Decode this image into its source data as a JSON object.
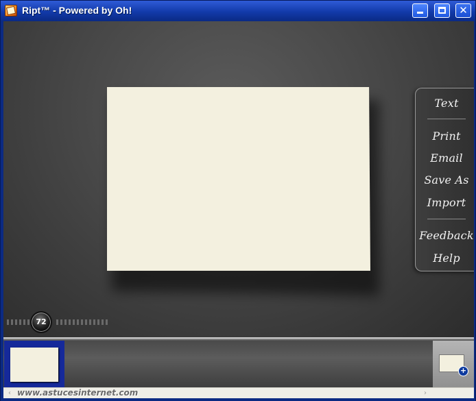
{
  "window": {
    "title": "Ript™ - Powered by Oh!",
    "controls": {
      "minimize": "minimize",
      "maximize": "maximize",
      "close": "✕"
    }
  },
  "menu": {
    "items": [
      "Text",
      "Print",
      "Email",
      "Save As",
      "Import",
      "Feedback",
      "Help"
    ]
  },
  "zoom": {
    "value": "72"
  },
  "filmstrip": {
    "add_icon": "+"
  },
  "footer": {
    "watermark": "www.astucesinternet.com"
  },
  "colors": {
    "canvas": "#f3f0df",
    "title_bar": "#123aa9",
    "selection": "#15299a"
  }
}
